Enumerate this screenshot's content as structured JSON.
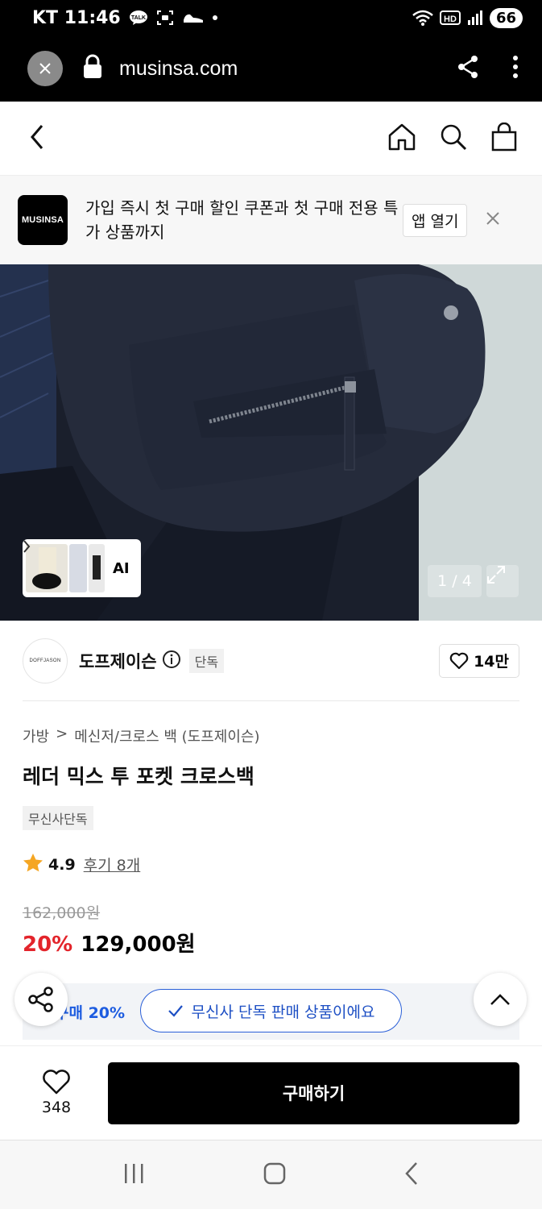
{
  "status_bar": {
    "carrier_time": "KT 11:46",
    "talk_label": "TALK",
    "hd_label": "HD",
    "battery": "66"
  },
  "browser": {
    "url": "musinsa.com"
  },
  "banner": {
    "logo": "MUSINSA",
    "text": "가입 즉시 첫 구매 할인 쿠폰과 첫 구매 전용 특가 상품까지",
    "app_open": "앱 열기"
  },
  "hero": {
    "ai_label": "AI",
    "pager": "1 / 4"
  },
  "brand": {
    "logo_text": "DOFFJASON",
    "name": "도프제이슨",
    "tag": "단독",
    "likes": "14만"
  },
  "product": {
    "breadcrumb": [
      "가방",
      ">",
      "메신저/크로스 백 (도프제이슨)"
    ],
    "title": "레더 믹스 투 포켓 크로스백",
    "tag": "무신사단독",
    "rating": "4.9",
    "reviews": "후기 8개",
    "original_price": "162,000원",
    "discount": "20%",
    "price": "129,000원"
  },
  "coupon": {
    "text": "구매 20%"
  },
  "toast": {
    "text": "무신사 단독 판매 상품이에요"
  },
  "bottom": {
    "wish_count": "348",
    "buy_label": "구매하기"
  },
  "colors": {
    "accent_red": "#e3242b",
    "accent_blue": "#1d4fc4",
    "star": "#f5a623"
  }
}
